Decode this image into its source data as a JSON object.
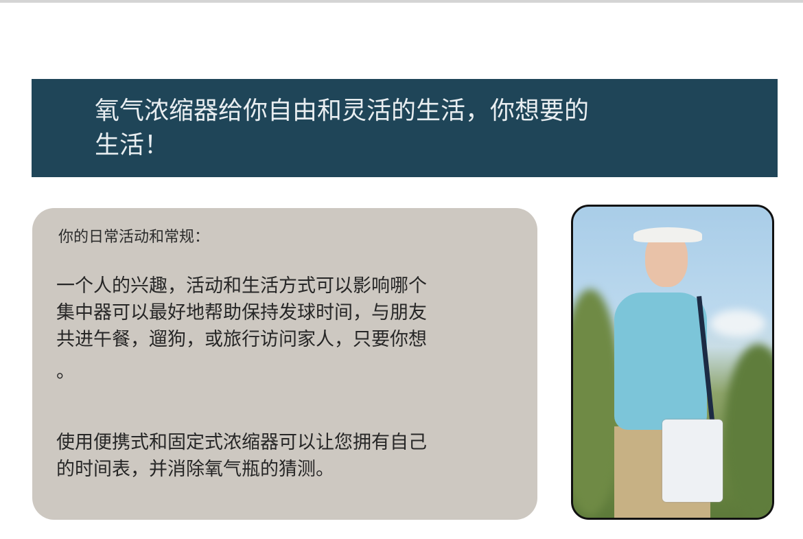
{
  "banner": {
    "title_lines": [
      "氧气浓缩器给你自由和灵活的生活，你想要的",
      "生活！"
    ]
  },
  "card": {
    "heading": "你的日常活动和常规：",
    "paragraph1_lines": [
      "一个人的兴趣，活动和生活方式可以影响哪个",
      "集中器可以最好地帮助保持发球时间，与朋友",
      "共进午餐，遛狗，或旅行访问家人，只要你想",
      "。"
    ],
    "paragraph2_lines": [
      "使用便携式和固定式浓缩器可以让您拥有自己",
      "的时间表，并消除氧气瓶的猜测。"
    ]
  },
  "colors": {
    "banner_bg": "#1f4558",
    "card_bg": "#cdc8c1"
  }
}
